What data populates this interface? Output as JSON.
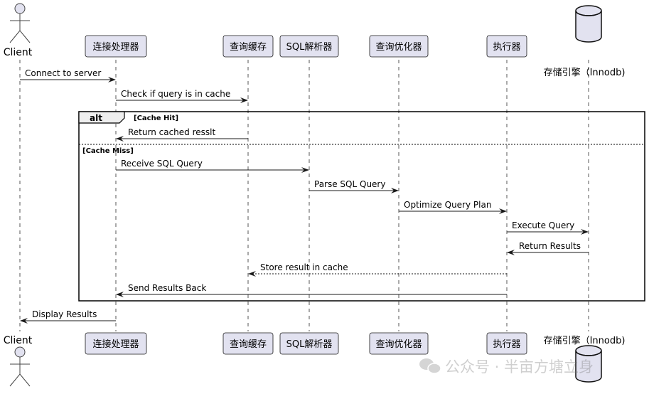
{
  "participants": [
    {
      "id": "client",
      "label": "Client",
      "kind": "actor"
    },
    {
      "id": "conn",
      "label": "连接处理器",
      "kind": "box"
    },
    {
      "id": "cache",
      "label": "查询缓存",
      "kind": "box"
    },
    {
      "id": "parser",
      "label": "SQL解析器",
      "kind": "box"
    },
    {
      "id": "optimizer",
      "label": "查询优化器",
      "kind": "box"
    },
    {
      "id": "executor",
      "label": "执行器",
      "kind": "box"
    },
    {
      "id": "storage",
      "label": "存储引擎（Innodb)",
      "kind": "database"
    }
  ],
  "messages": [
    {
      "from": "client",
      "to": "conn",
      "label": "Connect to server",
      "style": "solid"
    },
    {
      "from": "conn",
      "to": "cache",
      "label": "Check if query is in cache",
      "style": "solid"
    },
    {
      "from": "cache",
      "to": "conn",
      "label": "Return cached resslt",
      "style": "solid"
    },
    {
      "from": "conn",
      "to": "parser",
      "label": "Receive SQL Query",
      "style": "solid"
    },
    {
      "from": "parser",
      "to": "optimizer",
      "label": "Parse SQL Query",
      "style": "solid"
    },
    {
      "from": "optimizer",
      "to": "executor",
      "label": "Optimize Query Plan",
      "style": "solid"
    },
    {
      "from": "executor",
      "to": "storage",
      "label": "Execute Query",
      "style": "solid"
    },
    {
      "from": "storage",
      "to": "executor",
      "label": "Return Results",
      "style": "solid"
    },
    {
      "from": "executor",
      "to": "cache",
      "label": "Store result in cache",
      "style": "dashed"
    },
    {
      "from": "executor",
      "to": "conn",
      "label": "Send Results Back",
      "style": "solid"
    },
    {
      "from": "conn",
      "to": "client",
      "label": "Display Results",
      "style": "solid"
    }
  ],
  "fragment": {
    "keyword": "alt",
    "guard1": "[Cache Hit]",
    "guard2": "[Cache Miss]"
  },
  "watermark": "公众号 · 半亩方塘立身",
  "colors": {
    "participant_fill": "#E2E2F0",
    "participant_border": "#181818"
  }
}
